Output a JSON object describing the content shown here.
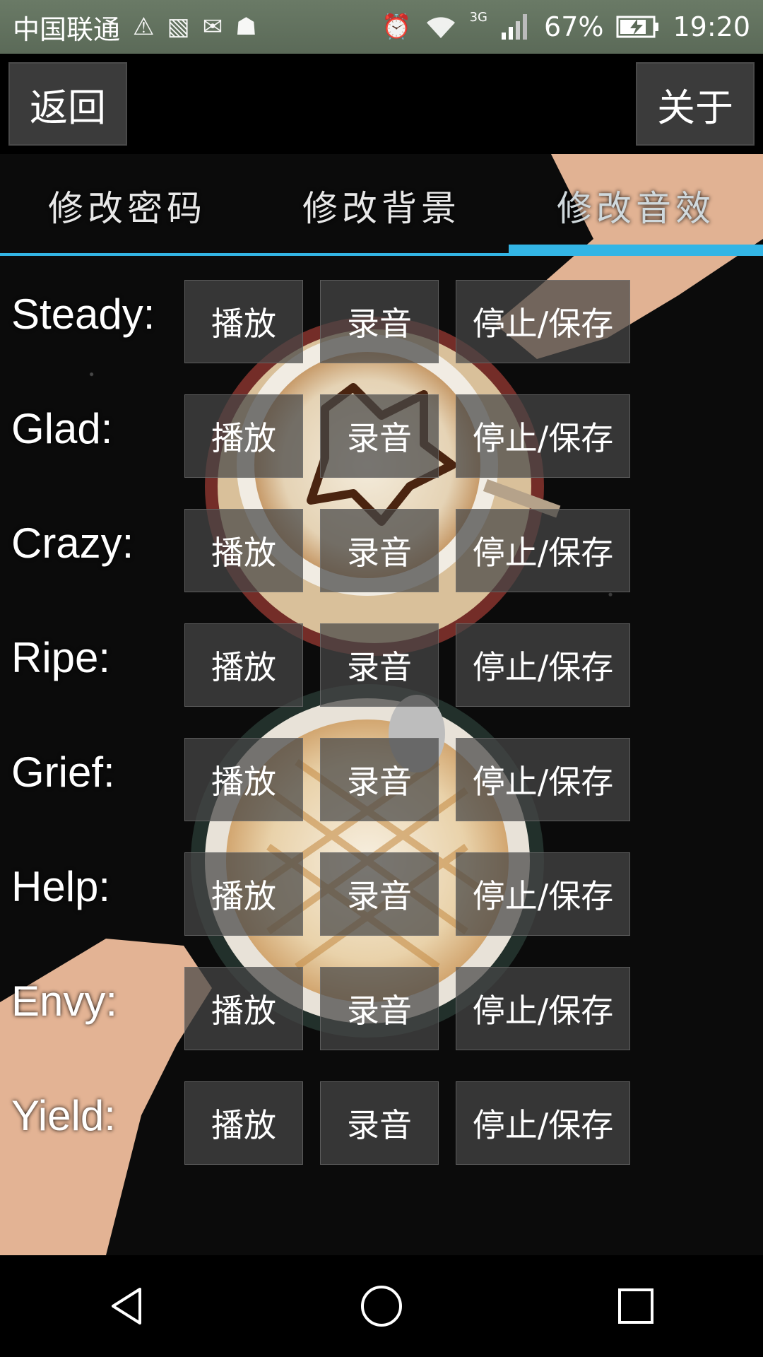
{
  "status_bar": {
    "carrier": "中国联通",
    "network": "3G",
    "battery": "67%",
    "time": "19:20",
    "icons": [
      "sim-warning-icon",
      "gallery-icon",
      "mail-notification-icon",
      "android-icon",
      "alarm-icon",
      "wifi-icon",
      "signal-icon",
      "battery-icon"
    ]
  },
  "topbar": {
    "back_label": "返回",
    "about_label": "关于"
  },
  "tabs": [
    {
      "label": "修改密码",
      "active": false
    },
    {
      "label": "修改背景",
      "active": false
    },
    {
      "label": "修改音效",
      "active": true
    }
  ],
  "rows": [
    {
      "label": "Steady:",
      "play": "播放",
      "record": "录音",
      "stop": "停止/保存"
    },
    {
      "label": "Glad:",
      "play": "播放",
      "record": "录音",
      "stop": "停止/保存"
    },
    {
      "label": "Crazy:",
      "play": "播放",
      "record": "录音",
      "stop": "停止/保存"
    },
    {
      "label": "Ripe:",
      "play": "播放",
      "record": "录音",
      "stop": "停止/保存"
    },
    {
      "label": "Grief:",
      "play": "播放",
      "record": "录音",
      "stop": "停止/保存"
    },
    {
      "label": "Help:",
      "play": "播放",
      "record": "录音",
      "stop": "停止/保存"
    },
    {
      "label": "Envy:",
      "play": "播放",
      "record": "录音",
      "stop": "停止/保存"
    },
    {
      "label": "Yield:",
      "play": "播放",
      "record": "录音",
      "stop": "停止/保存"
    }
  ],
  "colors": {
    "accent": "#33b5e5",
    "button_bg": "#464646"
  }
}
